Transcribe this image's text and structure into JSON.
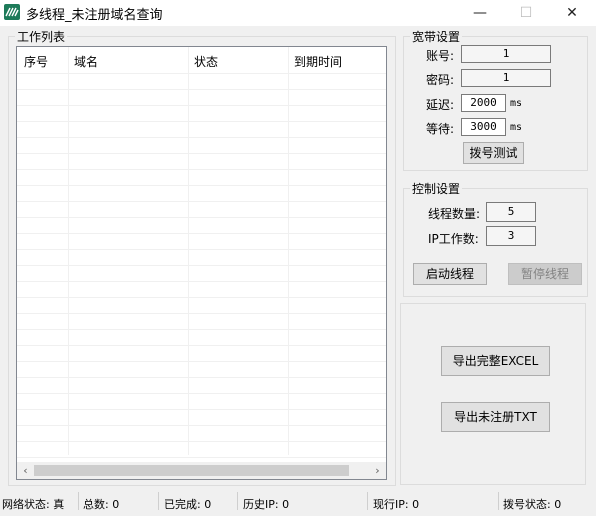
{
  "window": {
    "title": "多线程_未注册域名查询",
    "icons": [
      "minimize-icon",
      "maximize-icon",
      "close-icon"
    ],
    "minimize_glyph": "—",
    "maximize_glyph": "☐",
    "close_glyph": "✕"
  },
  "work_list": {
    "group_label": "工作列表",
    "columns": [
      "序号",
      "域名",
      "状态",
      "到期时间"
    ],
    "rows": [],
    "scroll_left_glyph": "‹",
    "scroll_right_glyph": "›"
  },
  "broadband": {
    "group_label": "宽带设置",
    "account_label": "账号:",
    "account_value": "1",
    "password_label": "密码:",
    "password_value": "1",
    "delay_label": "延迟:",
    "delay_value": "2000",
    "delay_unit": "ms",
    "wait_label": "等待:",
    "wait_value": "3000",
    "wait_unit": "ms",
    "dial_test_button": "拨号测试"
  },
  "control": {
    "group_label": "控制设置",
    "thread_count_label": "线程数量:",
    "thread_count_value": "5",
    "ip_work_label": "IP工作数:",
    "ip_work_value": "3",
    "start_button": "启动线程",
    "pause_button": "暂停线程"
  },
  "export": {
    "full_excel_button": "导出完整EXCEL",
    "unregistered_txt_button": "导出未注册TXT"
  },
  "statusbar": {
    "network": "网络状态: 真",
    "total": "总数: 0",
    "completed": "已完成: 0",
    "history_ip": "历史IP: 0",
    "current_ip": "现行IP: 0",
    "dial_status": "拨号状态: 0"
  }
}
